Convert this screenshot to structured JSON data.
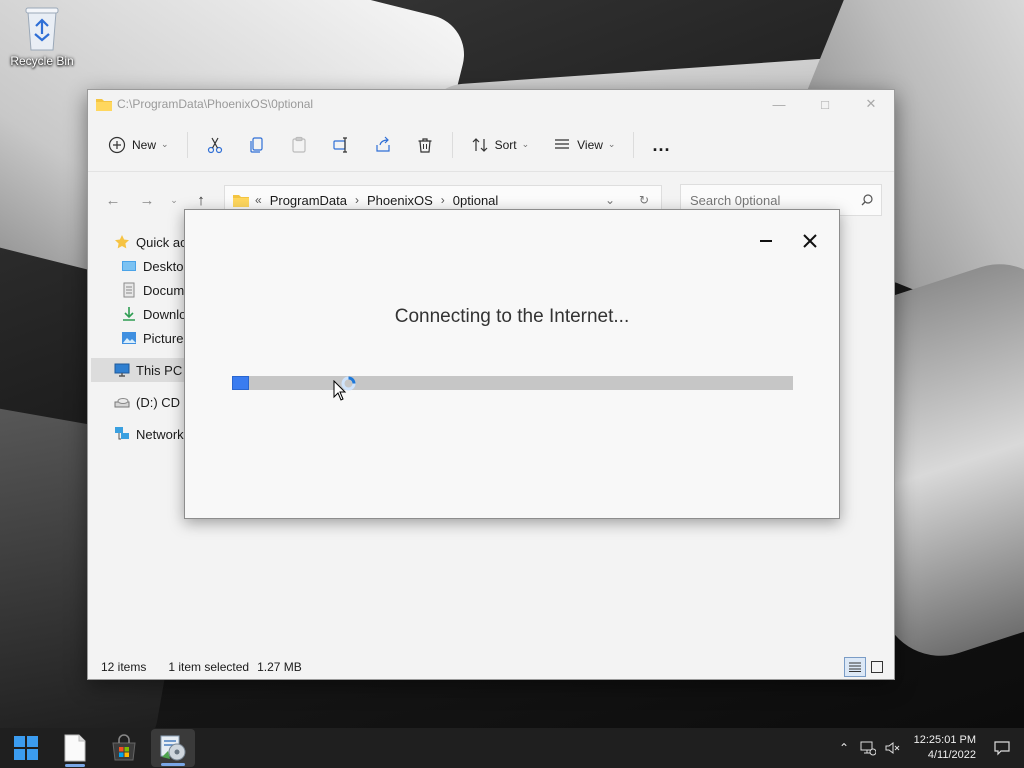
{
  "desktop": {
    "recycle_bin_label": "Recycle Bin"
  },
  "explorer": {
    "title": "C:\\ProgramData\\PhoenixOS\\0ptional",
    "toolbar": {
      "new_label": "New",
      "sort_label": "Sort",
      "view_label": "View",
      "more_label": "..."
    },
    "address": {
      "overflow": "«",
      "crumbs": [
        "ProgramData",
        "PhoenixOS",
        "0ptional"
      ]
    },
    "search": {
      "placeholder": "Search 0ptional"
    },
    "sidebar": {
      "items": [
        {
          "label": "Quick access",
          "icon": "star-icon"
        },
        {
          "label": "Desktop",
          "icon": "desktop-icon"
        },
        {
          "label": "Documents",
          "icon": "documents-icon"
        },
        {
          "label": "Downloads",
          "icon": "download-icon"
        },
        {
          "label": "Pictures",
          "icon": "pictures-icon"
        },
        {
          "label": "This PC",
          "icon": "computer-icon"
        },
        {
          "label": "(D:) CD Drive",
          "icon": "cd-drive-icon"
        },
        {
          "label": "Network",
          "icon": "network-icon"
        }
      ]
    },
    "status": {
      "item_count": "12 items",
      "selection": "1 item selected",
      "size": "1.27 MB"
    }
  },
  "dialog": {
    "message": "Connecting to the Internet...",
    "progress_fraction": 0.03,
    "accent_color": "#3a7cf0"
  },
  "taskbar": {
    "items": [
      "start-icon",
      "notepad-icon",
      "store-icon",
      "installer-icon"
    ],
    "time": "12:25:01 PM",
    "date": "4/11/2022"
  }
}
